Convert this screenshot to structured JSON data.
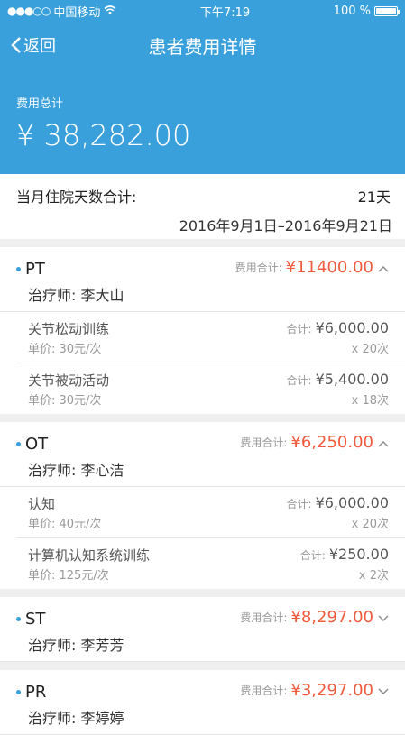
{
  "status": {
    "carrier": "中国移动",
    "time": "下午7:19",
    "battery": "100 %"
  },
  "nav": {
    "back_label": "返回",
    "title": "患者费用详情"
  },
  "summary": {
    "total_label": "费用总计",
    "total_amount": "¥ 38,282.00"
  },
  "stay": {
    "label": "当月住院天数合计:",
    "days": "21天",
    "range": "2016年9月1日–2016年9月21日"
  },
  "sections": [
    {
      "name": "PT",
      "therapist": "治疗师:  李大山",
      "total_label": "费用合计:",
      "total": "¥11400.00",
      "expanded": true,
      "items": [
        {
          "name": "关节松动训练",
          "unit": "单价:  30元/次",
          "sub_label": "合计:",
          "sub": "¥6,000.00",
          "qty": "x 20次"
        },
        {
          "name": "关节被动活动",
          "unit": "单价:  30元/次",
          "sub_label": "合计:",
          "sub": "¥5,400.00",
          "qty": "x 18次"
        }
      ]
    },
    {
      "name": "OT",
      "therapist": "治疗师:  李心洁",
      "total_label": "费用合计:",
      "total": "¥6,250.00",
      "expanded": true,
      "items": [
        {
          "name": "认知",
          "unit": "单价:  40元/次",
          "sub_label": "合计:",
          "sub": "¥6,000.00",
          "qty": "x 20次"
        },
        {
          "name": "计算机认知系统训练",
          "unit": "单价:  125元/次",
          "sub_label": "合计:",
          "sub": "¥250.00",
          "qty": "x 2次"
        }
      ]
    },
    {
      "name": "ST",
      "therapist": "治疗师:  李芳芳",
      "total_label": "费用合计:",
      "total": "¥8,297.00",
      "expanded": false,
      "items": []
    },
    {
      "name": "PR",
      "therapist": "治疗师:  李婷婷",
      "total_label": "费用合计:",
      "total": "¥3,297.00",
      "expanded": false,
      "items": []
    }
  ],
  "colors": {
    "header_bg": "#3aa0dc",
    "amount": "#ef5a3c"
  }
}
